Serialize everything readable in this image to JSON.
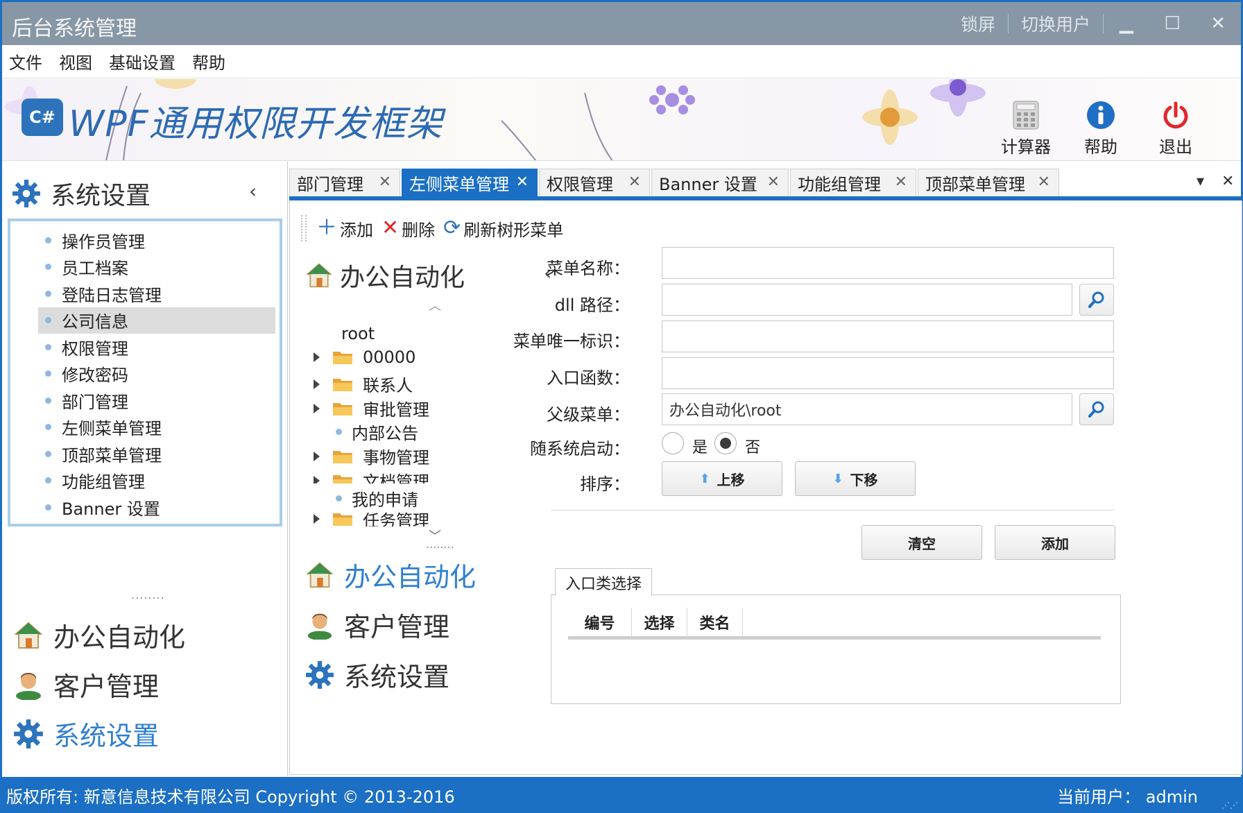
{
  "window": {
    "title": "后台系统管理",
    "lock_label": "锁屏",
    "switch_user_label": "切换用户",
    "minimize_glyph": "▁",
    "maximize_glyph": "☐",
    "close_glyph": "✕"
  },
  "menu": [
    "文件",
    "视图",
    "基础设置",
    "帮助"
  ],
  "banner": {
    "logo_text": "C#",
    "title": "WPF通用权限开发框架",
    "tools": [
      {
        "label": "计算器",
        "icon": "calculator-icon"
      },
      {
        "label": "帮助",
        "icon": "info-icon"
      },
      {
        "label": "退出",
        "icon": "power-icon"
      }
    ]
  },
  "leftnav": {
    "header": "系统设置",
    "collapse_glyph": "‹",
    "items": [
      "操作员管理",
      "员工档案",
      "登陆日志管理",
      "公司信息",
      "权限管理",
      "修改密码",
      "部门管理",
      "左侧菜单管理",
      "顶部菜单管理",
      "功能组管理",
      "Banner 设置"
    ],
    "selected_index": 3,
    "grip": "........",
    "groups": [
      {
        "label": "办公自动化",
        "icon": "home-icon"
      },
      {
        "label": "客户管理",
        "icon": "user-icon"
      },
      {
        "label": "系统设置",
        "icon": "gear-icon",
        "active": true
      }
    ]
  },
  "tabs": {
    "items": [
      "部门管理",
      "左侧菜单管理",
      "权限管理",
      "Banner 设置",
      "功能组管理",
      "顶部菜单管理"
    ],
    "active_index": 1,
    "close_glyph": "✕",
    "dropdown_glyph": "▾",
    "close_all_glyph": "✕"
  },
  "toolbar": {
    "add_label": "添加",
    "delete_label": "删除",
    "refresh_label": "刷新树形菜单"
  },
  "tree_panel": {
    "header": "办公自动化",
    "collapse_glyph": "‹",
    "scroll_up_glyph": "︿",
    "scroll_down_glyph": "﹀",
    "grip": "........",
    "nodes": [
      {
        "label": "root",
        "kind": "root"
      },
      {
        "label": "00000",
        "kind": "folder"
      },
      {
        "label": "联系人",
        "kind": "folder"
      },
      {
        "label": "审批管理",
        "kind": "folder"
      },
      {
        "label": "内部公告",
        "kind": "leaf"
      },
      {
        "label": "事物管理",
        "kind": "folder"
      },
      {
        "label": "文档管理",
        "kind": "folder"
      },
      {
        "label": "我的申请",
        "kind": "leaf"
      },
      {
        "label": "任务管理",
        "kind": "folder"
      }
    ],
    "accordion": [
      {
        "label": "办公自动化",
        "icon": "home-icon",
        "active": true
      },
      {
        "label": "客户管理",
        "icon": "user-icon"
      },
      {
        "label": "系统设置",
        "icon": "gear-icon"
      }
    ]
  },
  "form": {
    "menu_name_label": "菜单名称：",
    "menu_name_value": "",
    "dll_path_label": "dll 路径：",
    "dll_path_value": "",
    "unique_id_label": "菜单唯一标识：",
    "unique_id_value": "",
    "entry_func_label": "入口函数：",
    "entry_func_value": "",
    "parent_menu_label": "父级菜单：",
    "parent_menu_value": "办公自动化\\root",
    "autostart_label": "随系统启动：",
    "autostart_yes": "是",
    "autostart_no": "否",
    "autostart_selected": "否",
    "order_label": "排序：",
    "move_up_label": "上移",
    "move_down_label": "下移",
    "clear_label": "清空",
    "add_label": "添加"
  },
  "entry_class": {
    "tab_label": "入口类选择",
    "columns": [
      "编号",
      "选择",
      "类名"
    ]
  },
  "status": {
    "left": "版权所有: 新意信息技术有限公司  Copyright © 2013-2016",
    "right": "当前用户：  admin"
  },
  "colors": {
    "accent": "#1b6fc4",
    "titlebar": "#8897a5",
    "link_active": "#2f7fd0",
    "banner_title": "#2d6ab2",
    "exit_red": "#e0282d"
  }
}
